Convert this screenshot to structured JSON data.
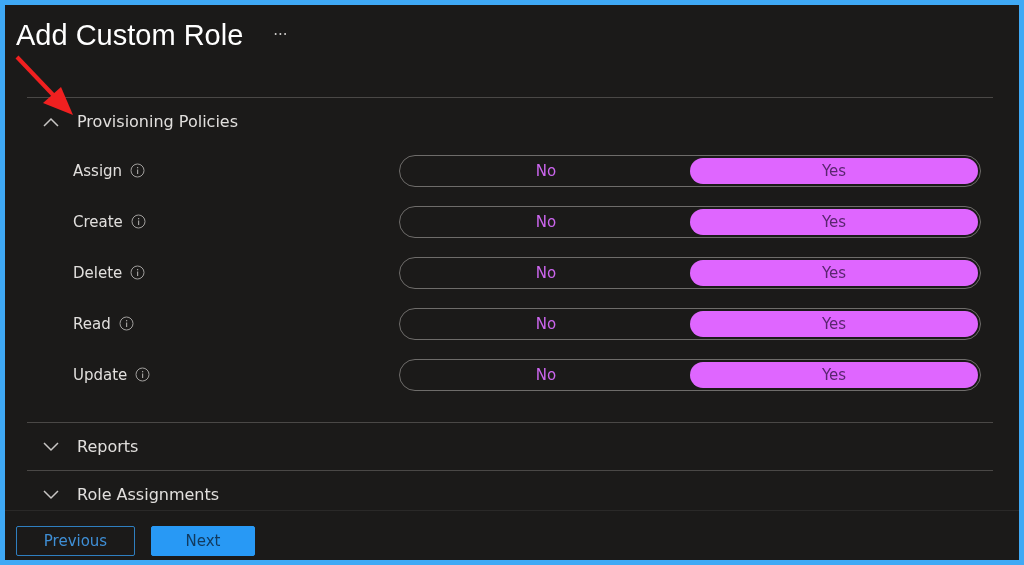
{
  "page": {
    "title": "Add Custom Role",
    "more": "···"
  },
  "sections": [
    {
      "title": "Provisioning Policies",
      "expanded": true,
      "permissions": [
        {
          "label": "Assign",
          "options": [
            {
              "label": "No",
              "selected": false
            },
            {
              "label": "Yes",
              "selected": true
            }
          ]
        },
        {
          "label": "Create",
          "options": [
            {
              "label": "No",
              "selected": false
            },
            {
              "label": "Yes",
              "selected": true
            }
          ]
        },
        {
          "label": "Delete",
          "options": [
            {
              "label": "No",
              "selected": false
            },
            {
              "label": "Yes",
              "selected": true
            }
          ]
        },
        {
          "label": "Read",
          "options": [
            {
              "label": "No",
              "selected": false
            },
            {
              "label": "Yes",
              "selected": true
            }
          ]
        },
        {
          "label": "Update",
          "options": [
            {
              "label": "No",
              "selected": false
            },
            {
              "label": "Yes",
              "selected": true
            }
          ]
        }
      ]
    },
    {
      "title": "Reports",
      "expanded": false
    },
    {
      "title": "Role Assignments",
      "expanded": false
    }
  ],
  "footer": {
    "buttons": [
      {
        "label": "Previous",
        "kind": "secondary"
      },
      {
        "label": "Next",
        "kind": "primary"
      }
    ]
  }
}
